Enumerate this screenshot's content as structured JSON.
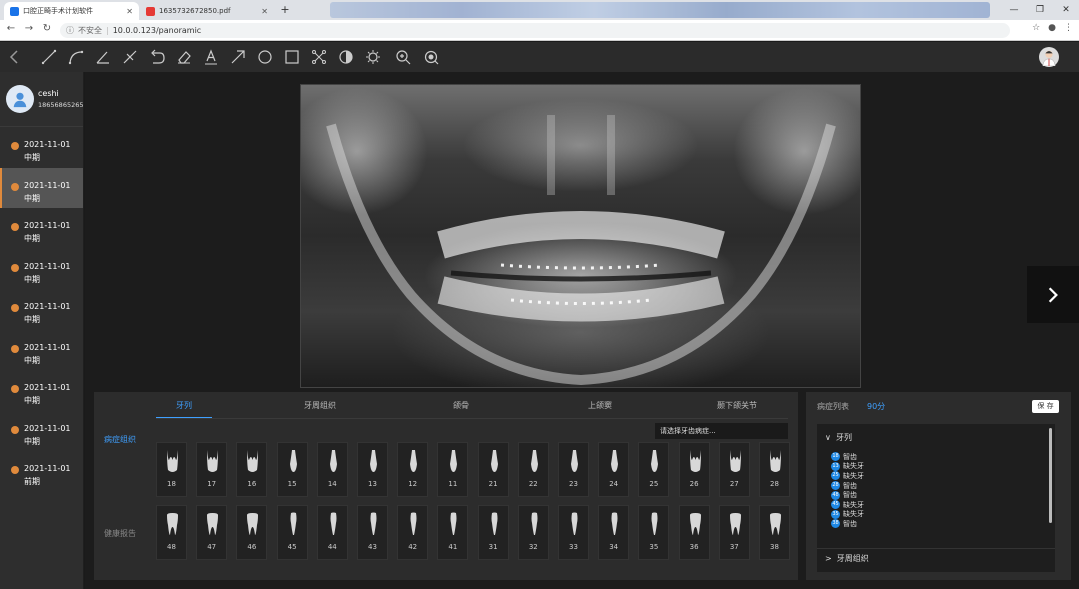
{
  "browser": {
    "tabs": [
      {
        "title": "口腔正畸手术计划软件"
      },
      {
        "title": "1635732672850.pdf"
      }
    ],
    "new_tab": "+",
    "window_controls": [
      "—",
      "❐",
      "✕"
    ],
    "security_label": "不安全",
    "url": "10.0.0.123/panoramic"
  },
  "toolbar": {
    "tools": [
      "back-arrow-icon",
      "line-icon",
      "curve-icon",
      "angle-icon",
      "cross-line-icon",
      "undo-icon",
      "eraser-icon",
      "text-tool-icon",
      "arrow-tool-icon",
      "circle-tool-icon",
      "rectangle-tool-icon",
      "crop-tool-icon",
      "contrast-icon",
      "brightness-icon",
      "zoom-in-icon",
      "magnifier-icon"
    ]
  },
  "user": {
    "name": "ceshi",
    "phone": "18656865265"
  },
  "records": [
    {
      "date": "2021-11-01",
      "stage": "中期"
    },
    {
      "date": "2021-11-01",
      "stage": "中期"
    },
    {
      "date": "2021-11-01",
      "stage": "中期"
    },
    {
      "date": "2021-11-01",
      "stage": "中期"
    },
    {
      "date": "2021-11-01",
      "stage": "中期"
    },
    {
      "date": "2021-11-01",
      "stage": "中期"
    },
    {
      "date": "2021-11-01",
      "stage": "中期"
    },
    {
      "date": "2021-11-01",
      "stage": "中期"
    },
    {
      "date": "2021-11-01",
      "stage": "前期"
    }
  ],
  "panel": {
    "tabs": [
      "牙列",
      "牙周组织",
      "颌骨",
      "上颌窦",
      "颞下颌关节"
    ],
    "left_labels": {
      "disease": "病症组织",
      "healthy": "健康报告"
    },
    "hint": "请选择牙齿病症...",
    "upper_teeth": [
      "18",
      "17",
      "16",
      "15",
      "14",
      "13",
      "12",
      "11",
      "21",
      "22",
      "23",
      "24",
      "25",
      "26",
      "27",
      "28"
    ],
    "lower_teeth": [
      "48",
      "47",
      "46",
      "45",
      "44",
      "43",
      "42",
      "41",
      "31",
      "32",
      "33",
      "34",
      "35",
      "36",
      "37",
      "38"
    ]
  },
  "findings": {
    "title": "病症列表",
    "score": "90分",
    "save": "保 存",
    "section": "牙列",
    "chevron_open": "∨",
    "chevron_closed": ">",
    "items": [
      {
        "tooth": "18",
        "label": "智齿"
      },
      {
        "tooth": "13",
        "label": "缺失牙"
      },
      {
        "tooth": "25",
        "label": "缺失牙"
      },
      {
        "tooth": "28",
        "label": "智齿"
      },
      {
        "tooth": "48",
        "label": "智齿"
      },
      {
        "tooth": "45",
        "label": "缺失牙"
      },
      {
        "tooth": "35",
        "label": "缺失牙"
      },
      {
        "tooth": "38",
        "label": "智齿"
      }
    ],
    "footer": "牙周组织"
  },
  "colors": {
    "accent": "#3fa0ff",
    "record_dot": "#e08a3c",
    "badge": "#1e88e5"
  }
}
